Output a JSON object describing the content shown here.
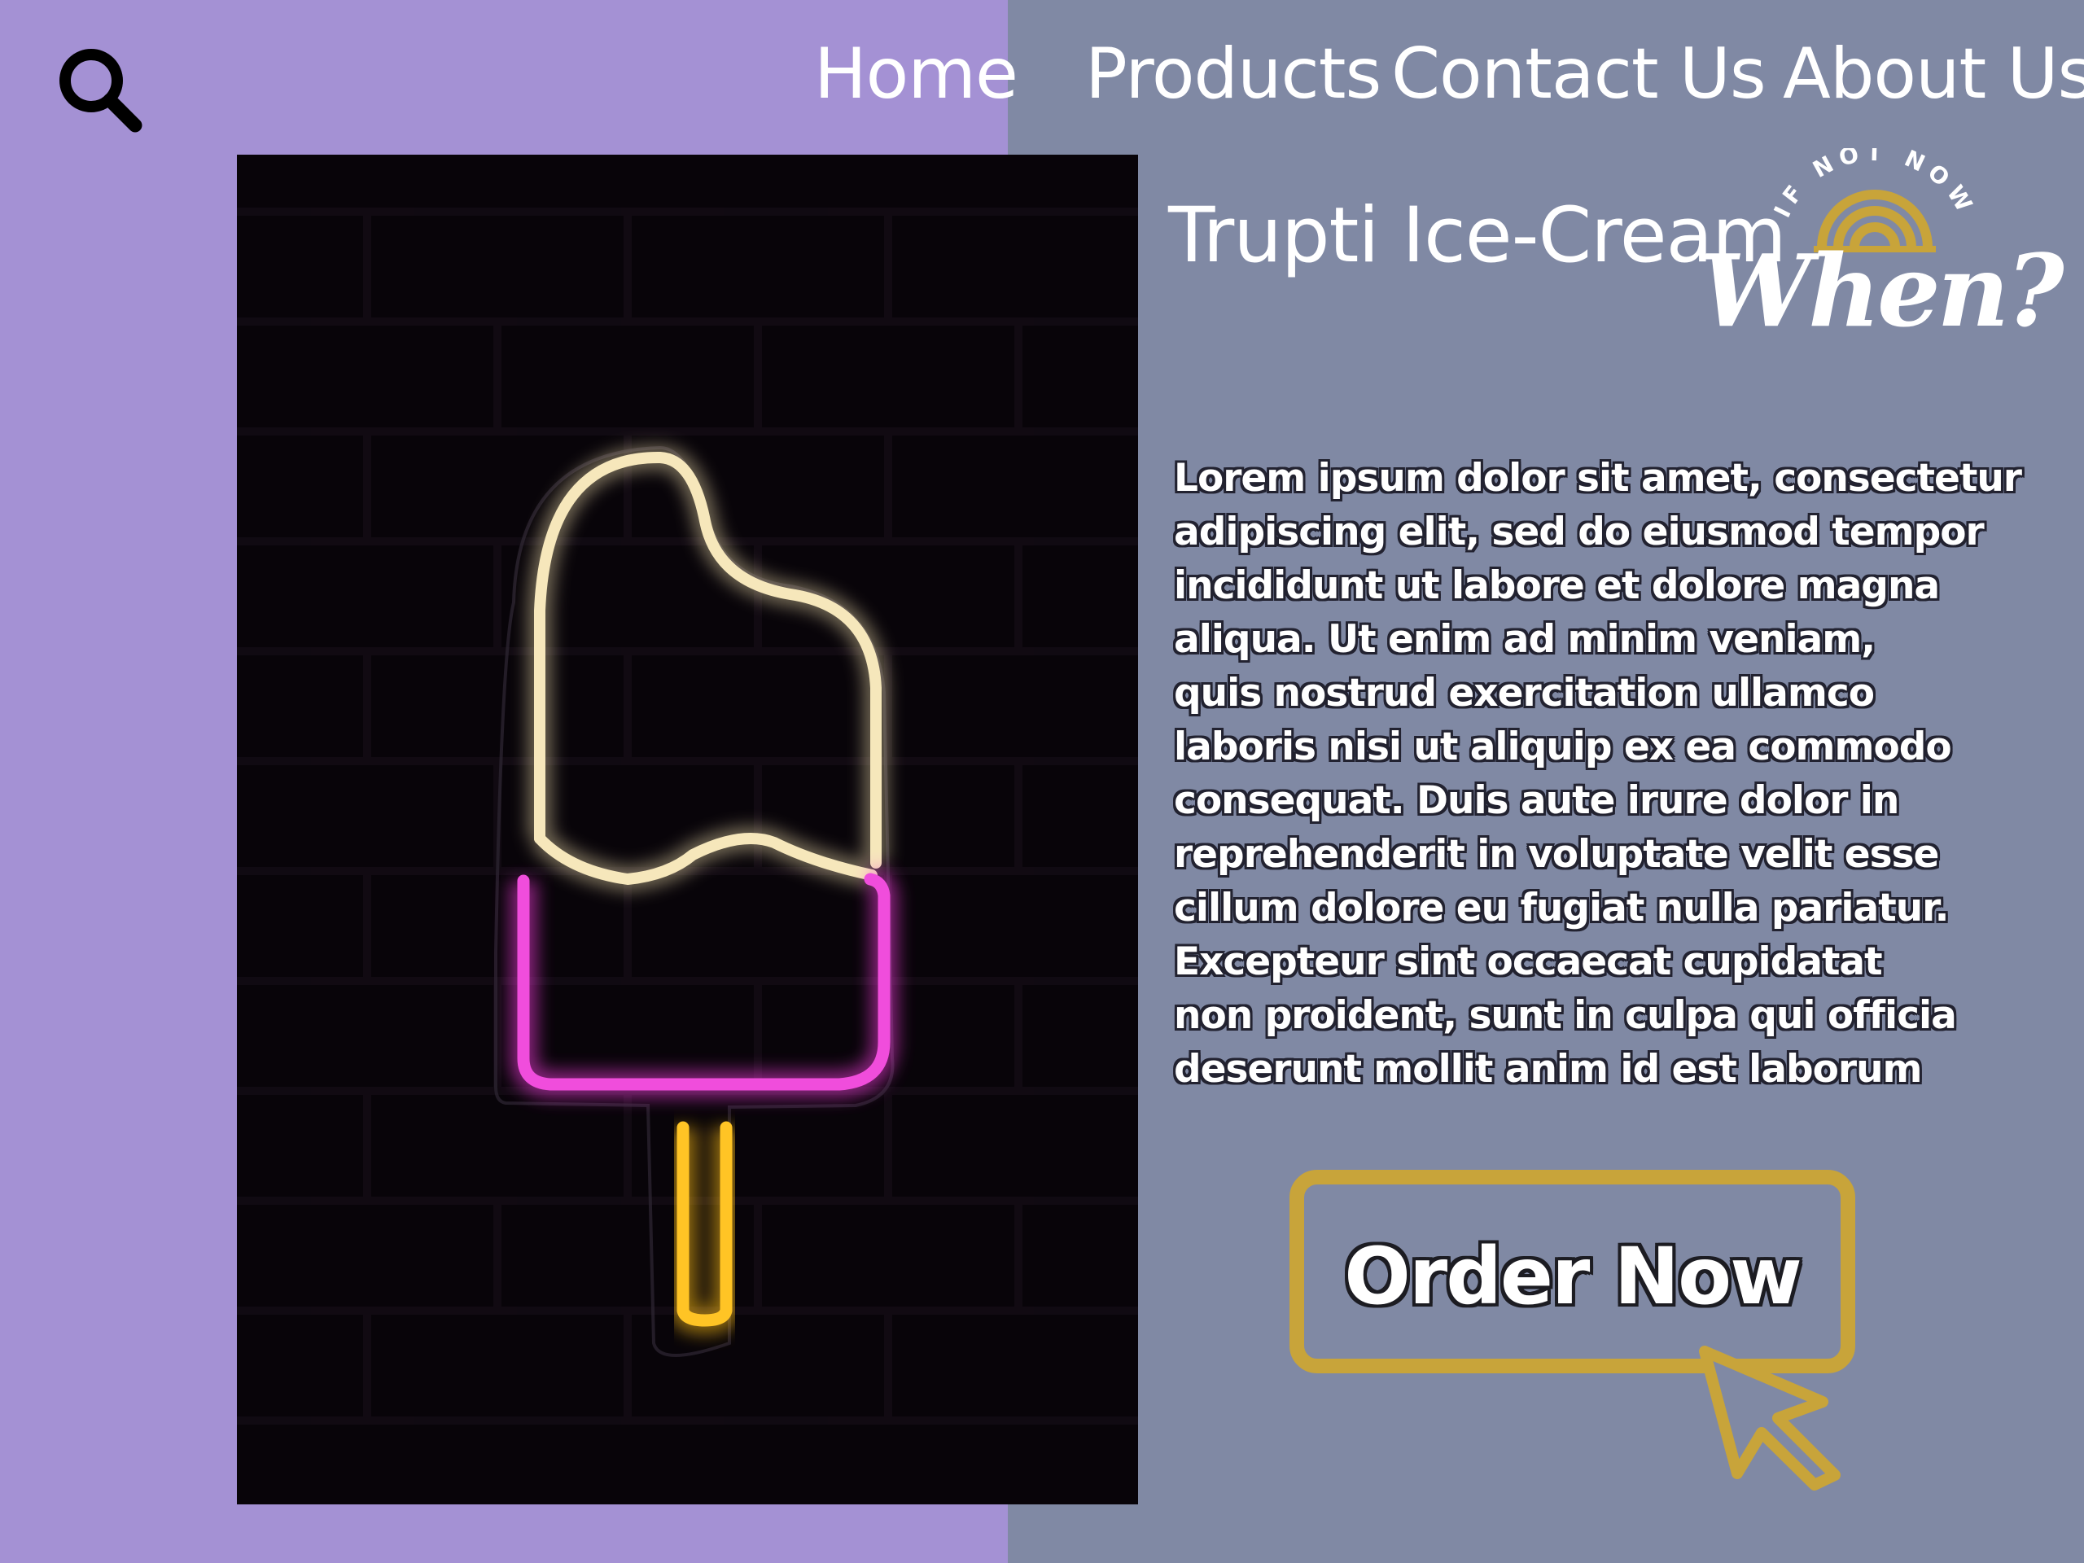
{
  "nav": {
    "search_icon": "search-icon",
    "links": [
      "Home",
      "Products",
      "Contact Us",
      "About Us"
    ]
  },
  "hero": {
    "image": "neon-popsicle-sign-on-dark-brick-wall"
  },
  "brand": {
    "title": "Trupti Ice-Cream",
    "badge_top_text": "IF NOT NOW",
    "badge_main_text": "When?"
  },
  "content": {
    "description": "Lorem ipsum dolor sit amet, consectetur\nadipiscing elit, sed do eiusmod tempor\nincididunt ut labore et dolore magna\naliqua. Ut enim ad minim veniam,\nquis nostrud exercitation ullamco\nlaboris nisi ut aliquip ex ea commodo\nconsequat. Duis aute irure dolor in\nreprehenderit in voluptate velit esse\ncillum dolore eu fugiat nulla pariatur.\nExcepteur sint occaecat cupidatat\nnon proident, sunt in culpa qui officia\ndeserunt mollit anim id est laborum"
  },
  "cta": {
    "label": "Order Now",
    "cursor_icon": "pointer-cursor-icon"
  },
  "colors": {
    "left_bg": "#a491d4",
    "right_bg": "#8089a4",
    "accent_gold": "#c8a43a",
    "neon_cream": "#f3e2b0",
    "neon_pink": "#ec3ad6",
    "neon_yellow": "#ffbf18"
  }
}
